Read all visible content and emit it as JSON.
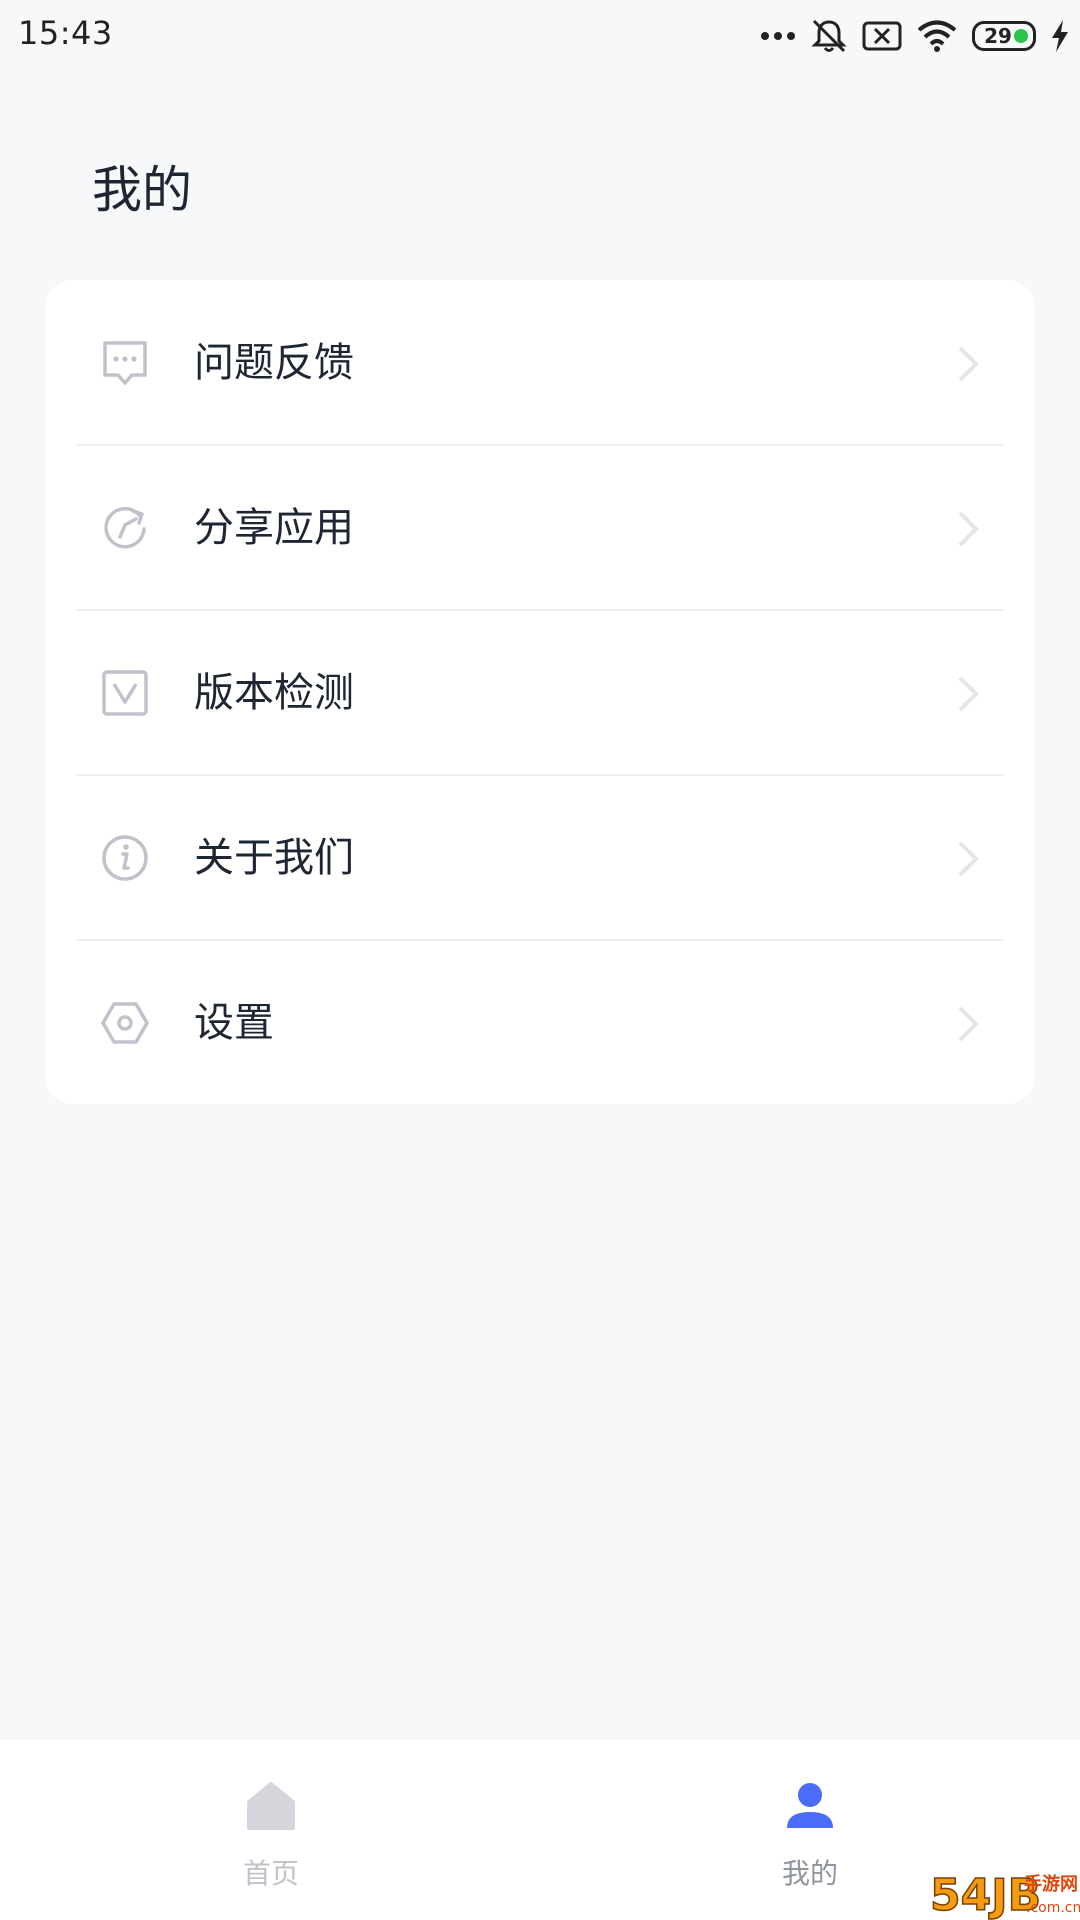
{
  "status_bar": {
    "time": "15:43",
    "battery_level": "29",
    "icons": [
      "more-dots-icon",
      "mute-bell-icon",
      "sim-off-icon",
      "wifi-icon",
      "battery-icon",
      "charging-bolt-icon"
    ]
  },
  "page": {
    "title": "我的"
  },
  "menu": {
    "items": [
      {
        "label": "问题反馈",
        "icon": "feedback-chat-icon"
      },
      {
        "label": "分享应用",
        "icon": "share-refresh-icon"
      },
      {
        "label": "版本检测",
        "icon": "version-check-icon"
      },
      {
        "label": "关于我们",
        "icon": "info-icon"
      },
      {
        "label": "设置",
        "icon": "settings-hexagon-icon"
      }
    ]
  },
  "bottom_nav": {
    "items": [
      {
        "label": "首页",
        "icon": "home-icon",
        "active": false
      },
      {
        "label": "我的",
        "icon": "user-icon",
        "active": true
      }
    ]
  },
  "colors": {
    "background": "#f7f8fa",
    "card": "#ffffff",
    "text_primary": "#1f2633",
    "icon_gray": "#bfc2ca",
    "accent_blue": "#4a6cf7",
    "watermark_orange": "#f39c12"
  },
  "watermark": {
    "text": "54JB手游网",
    "domain": ".com.cn"
  }
}
